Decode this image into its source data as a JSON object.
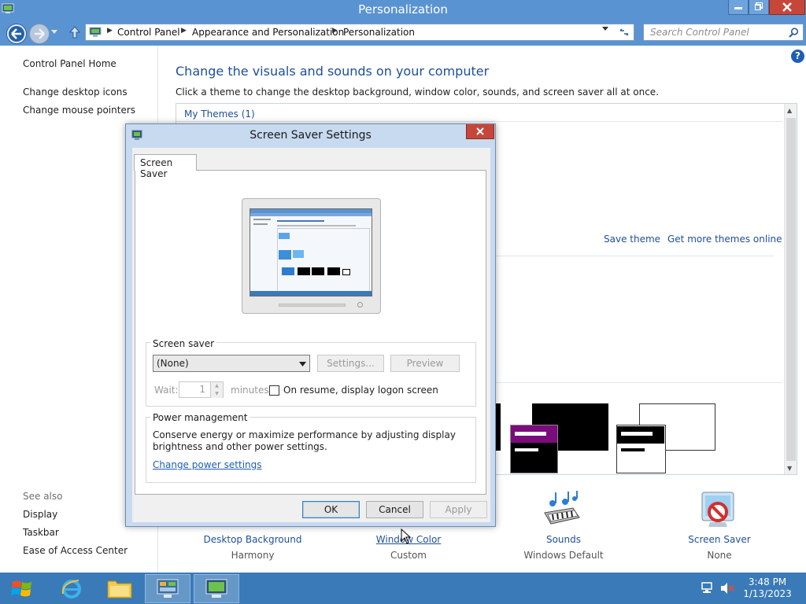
{
  "window": {
    "title": "Personalization",
    "colors": {
      "titlebar": "#5a93d1",
      "close": "#c7463a",
      "link": "#1e4f9a",
      "taskbar": "#3a7ab8"
    }
  },
  "address": {
    "crumbs": [
      "Control Panel",
      "Appearance and Personalization",
      "Personalization"
    ]
  },
  "search": {
    "placeholder": "Search Control Panel"
  },
  "sidebar": {
    "home": "Control Panel Home",
    "links": [
      "Change desktop icons",
      "Change mouse pointers"
    ],
    "see_also_title": "See also",
    "see_also": [
      "Display",
      "Taskbar",
      "Ease of Access Center"
    ]
  },
  "content": {
    "heading": "Change the visuals and sounds on your computer",
    "description": "Click a theme to change the desktop background, window color, sounds, and screen saver all at once.",
    "my_themes": "My Themes (1)",
    "save_theme": "Save theme",
    "get_more": "Get more themes online"
  },
  "bottom_items": [
    {
      "label": "Desktop Background",
      "sub": "Harmony"
    },
    {
      "label": "Window Color",
      "sub": "Custom"
    },
    {
      "label": "Sounds",
      "sub": "Windows Default"
    },
    {
      "label": "Screen Saver",
      "sub": "None"
    }
  ],
  "dialog": {
    "title": "Screen Saver Settings",
    "tab": "Screen Saver",
    "screen_saver_group": "Screen saver",
    "selected_saver": "(None)",
    "settings_button": "Settings...",
    "preview_button": "Preview",
    "wait_label": "Wait:",
    "wait_value": "1",
    "minutes_label": "minutes",
    "resume_checkbox": "On resume, display logon screen",
    "resume_checked": false,
    "power_group": "Power management",
    "power_text_1": "Conserve energy or maximize performance by adjusting display",
    "power_text_2": "brightness and other power settings.",
    "power_link": "Change power settings",
    "ok": "OK",
    "cancel": "Cancel",
    "apply": "Apply"
  },
  "taskbar": {
    "time": "3:48 PM",
    "date": "1/13/2023"
  }
}
